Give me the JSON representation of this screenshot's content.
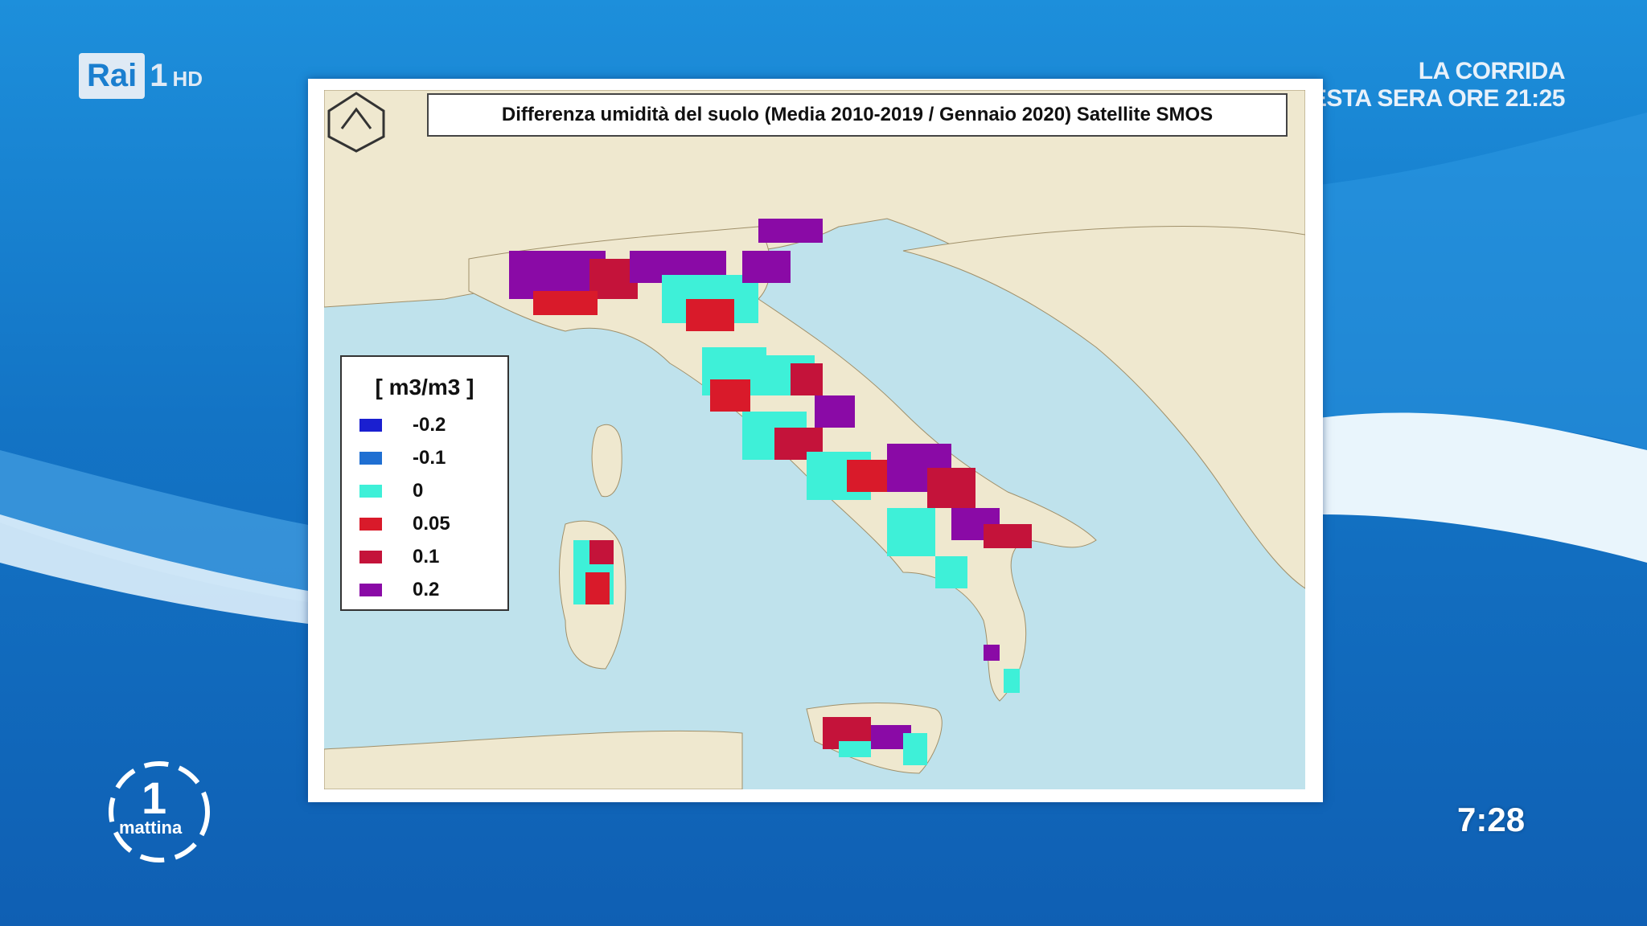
{
  "channel": {
    "brand": "Rai",
    "number": "1",
    "quality": "HD"
  },
  "promo": {
    "line1": "LA CORRIDA",
    "line2": "ESTA SERA ORE 21:25"
  },
  "map": {
    "title": "Differenza umidità del suolo (Media 2010-2019 / Gennaio 2020) Satellite SMOS",
    "legend": {
      "unit": "[ m3/m3 ]",
      "items": [
        {
          "label": "-0.2",
          "color": "#1a1fd0"
        },
        {
          "label": "-0.1",
          "color": "#1f6fd2"
        },
        {
          "label": "0",
          "color": "#3ef0d8"
        },
        {
          "label": "0.05",
          "color": "#d91a2a"
        },
        {
          "label": "0.1",
          "color": "#c4133a"
        },
        {
          "label": "0.2",
          "color": "#8a0aa6"
        }
      ]
    },
    "colors": {
      "sea": "#bfe2ec",
      "land": "#efe8cf",
      "border": "#a0906a"
    }
  },
  "program": {
    "number": "1",
    "name": "mattina"
  },
  "clock": "7:28"
}
